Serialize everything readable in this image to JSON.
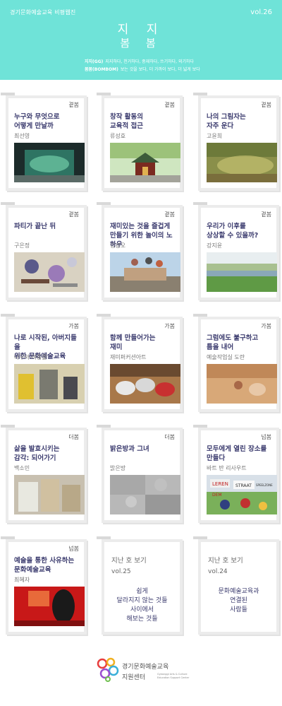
{
  "header": {
    "magazine_label": "경기문화예술교육 비평웹진",
    "volume": "vol.26",
    "title_line1": "지 지",
    "title_line2": "봄 봄",
    "tagline1_key": "지지(GG)",
    "tagline1_text": "지지하다, 천거하다, 중재하다, 쓰기하다, 외기하다",
    "tagline2_key": "봄봄(BOMBOM)",
    "tagline2_text": "보는 것을 보다, 더 가까이 보다, 더 넓게 보다"
  },
  "cards": [
    {
      "category": "곁봄",
      "title": "누구와 무엇으로\n어떻게 만날까",
      "author": "최선영"
    },
    {
      "category": "곁봄",
      "title": "창작 활동의\n교육적 접근",
      "author": "류성효"
    },
    {
      "category": "곁봄",
      "title": "나의 그림자는\n자주 운다",
      "author": "고윤희"
    },
    {
      "category": "곁봄",
      "title": "파티가 끝난 뒤",
      "author": "구은정"
    },
    {
      "category": "곁봄",
      "title": "재미있는 것을 즐겁게\n만들기 위한 놀이의 노하우",
      "author": "김경오"
    },
    {
      "category": "곁봄",
      "title": "우리가 이후를\n상상할 수 있을까?",
      "author": "강지윤"
    },
    {
      "category": "가봄",
      "title": "나로 시작된, 아버지들을\n위한 문화예술교육",
      "author": "나무와 마중물"
    },
    {
      "category": "가봄",
      "title": "함께 만들어가는\n재미",
      "author": "재미퍼커션아트"
    },
    {
      "category": "가봄",
      "title": "그럼에도 불구하고\n틈을 내어",
      "author": "예술작업실 도란"
    },
    {
      "category": "더봄",
      "title": "삶을 발효시키는\n감각: 되어가기",
      "author": "백소민"
    },
    {
      "category": "더봄",
      "title": "밝은방과 그녀",
      "author": "밝은방"
    },
    {
      "category": "넘봄",
      "title": "모두에게 열린 장소를\n만들다",
      "author": "바트 반 리사우트"
    },
    {
      "category": "넘봄",
      "title": "예술을 통한 사유하는\n문화예술교육",
      "author": "최혜자"
    }
  ],
  "previous_issues": [
    {
      "heading": "지난 호 보기",
      "volume": "vol.25",
      "lines": [
        "쉽게",
        "달라지지 않는 것들",
        "사이에서",
        "해보는 것들"
      ]
    },
    {
      "heading": "지난 호 보기",
      "volume": "vol.24",
      "lines": [
        "문화예술교육과",
        "연결된",
        "사람들"
      ]
    }
  ],
  "photo_signs": [
    "LEREN",
    "DEM",
    "STRAAT",
    "SPEELZONE"
  ],
  "footer": {
    "logo_line1": "경기문화예술교육",
    "logo_line2": "지원센터",
    "logo_en": "Gyeonggi Arts & Culture Education Support Center"
  },
  "colors": {
    "header_bg": "#6fe3d8",
    "title_text": "#3b3b6e",
    "card_border": "#ececec"
  }
}
